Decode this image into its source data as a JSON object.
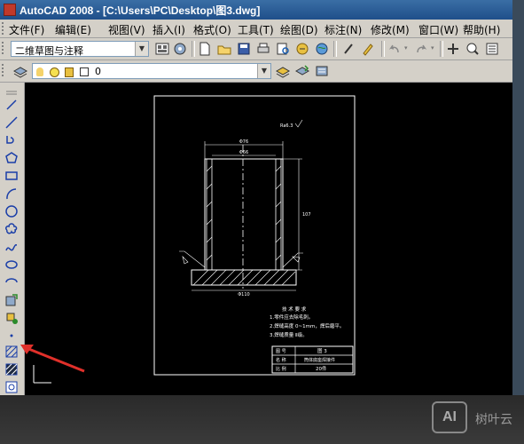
{
  "window": {
    "title": "AutoCAD 2008 - [C:\\Users\\PC\\Desktop\\图3.dwg]"
  },
  "menu": [
    {
      "label": "文件(F)"
    },
    {
      "label": "编辑(E)"
    },
    {
      "label": "视图(V)"
    },
    {
      "label": "插入(I)"
    },
    {
      "label": "格式(O)"
    },
    {
      "label": "工具(T)"
    },
    {
      "label": "绘图(D)"
    },
    {
      "label": "标注(N)"
    },
    {
      "label": "修改(M)"
    },
    {
      "label": "窗口(W)"
    },
    {
      "label": "帮助(H)"
    }
  ],
  "toolbar": {
    "workspace_value": "二维草图与注释",
    "layer_value": "0"
  },
  "drawing": {
    "dim_top_outer": "Φ76",
    "dim_top_inner": "Φ66",
    "dim_height": "107",
    "dim_base": "Φ110",
    "surface_mark": "Ra6.3",
    "notes_title": "技 术 要 求",
    "note1": "1.零件应去除毛刺。",
    "note2": "2.焊缝高度 0~1mm，焊后磨平。",
    "note3": "3.焊缝质量 Ⅱ级。",
    "table_r1c1": "图 号",
    "table_r1c2": "图 3",
    "table_r2c1": "名 称",
    "table_r2c2": "筒体底座焊接件",
    "table_r3c1": "比 例",
    "table_r3c2": "20件"
  },
  "watermark": {
    "logo": "AI",
    "text": "树叶云"
  },
  "colors": {
    "title_bar": "#1f4f8a",
    "canvas": "#000000",
    "annotation_arrow": "#e0302a"
  }
}
